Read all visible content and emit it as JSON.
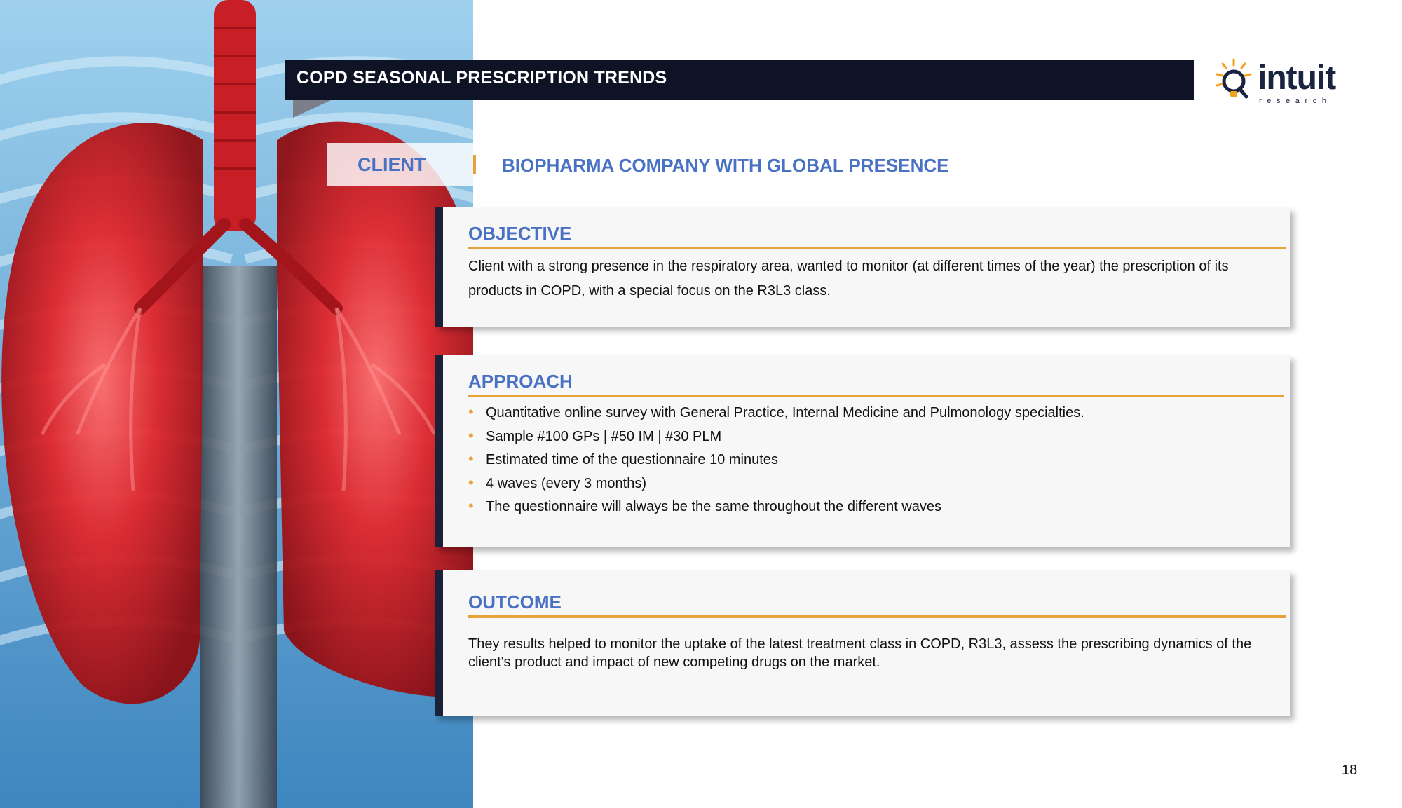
{
  "title": "COPD SEASONAL PRESCRIPTION TRENDS",
  "logo": {
    "word": "intuit",
    "sub": "research"
  },
  "client": {
    "label": "CLIENT",
    "value": "BIOPHARMA COMPANY WITH GLOBAL PRESENCE"
  },
  "objective": {
    "heading": "OBJECTIVE",
    "text": "Client with a strong presence in the respiratory area, wanted to monitor (at different times of the year) the prescription of its products in COPD, with a special focus on the R3L3 class."
  },
  "approach": {
    "heading": "APPROACH",
    "items": [
      "Quantitative online survey with General Practice, Internal Medicine and Pulmonology specialties.",
      "Sample #100 GPs | #50 IM | #30 PLM",
      "Estimated time of the questionnaire 10 minutes",
      "4 waves (every 3 months)",
      "The questionnaire will always be the same throughout the different waves"
    ]
  },
  "outcome": {
    "heading": "OUTCOME",
    "text": "They results helped to monitor the uptake of the latest treatment class in COPD, R3L3, assess the prescribing dynamics of the client's product and impact of new competing drugs on the market."
  },
  "page_number": "18",
  "colors": {
    "title_bar": "#0e1326",
    "accent_blue": "#4a72c4",
    "accent_orange": "#e7a23a",
    "card_stripe": "#1a2138"
  },
  "image": {
    "description_icon": "lungs-xray-illustration"
  }
}
